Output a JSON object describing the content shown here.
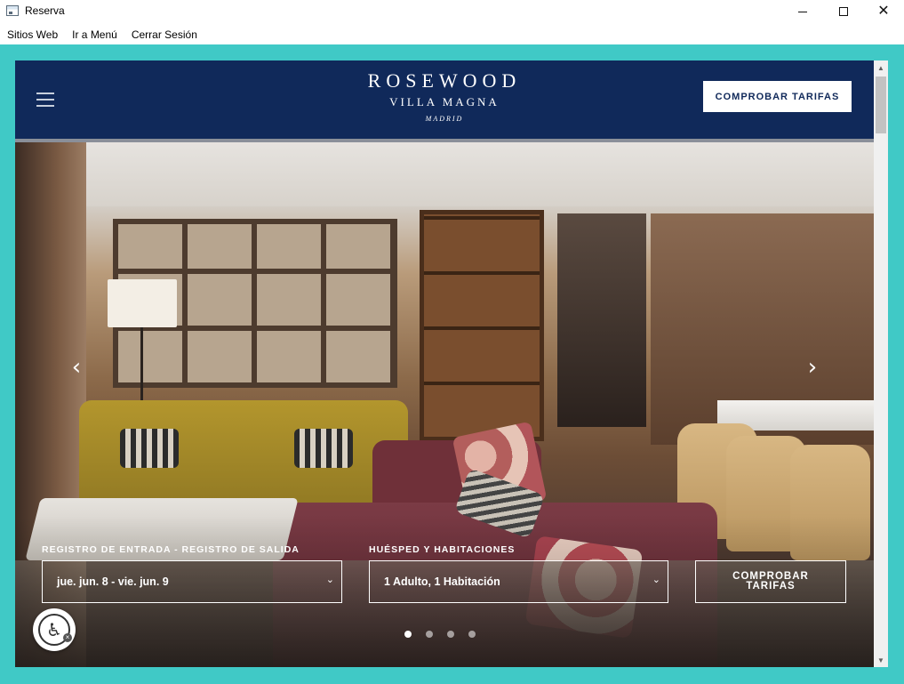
{
  "window": {
    "title": "Reserva",
    "controls": {
      "minimize": "minimize",
      "maximize": "maximize",
      "close": "✕"
    }
  },
  "menubar": {
    "items": [
      {
        "label": "Sitios Web"
      },
      {
        "label": "Ir a Menú"
      },
      {
        "label": "Cerrar Sesión"
      }
    ]
  },
  "colors": {
    "frame_teal": "#40c9c6",
    "header_navy": "#10295a",
    "white": "#ffffff"
  },
  "site": {
    "logo": {
      "main": "ROSEWOOD",
      "sub": "VILLA MAGNA",
      "city": "MADRID"
    },
    "header_cta": "COMPROBAR TARIFAS",
    "menu_icon": "hamburger-menu-icon"
  },
  "hero": {
    "prev_icon": "chevron-left-icon",
    "next_icon": "chevron-right-icon",
    "slides_total": 4,
    "active_slide": 1
  },
  "booking": {
    "dates_label": "REGISTRO DE ENTRADA - REGISTRO DE SALIDA",
    "dates_value": "jue. jun. 8 - vie. jun. 9",
    "guests_label": "HUÉSPED Y HABITACIONES",
    "guests_value": "1 Adulto, 1 Habitación",
    "cta": "COMPROBAR TARIFAS"
  },
  "accessibility": {
    "icon": "accessibility-icon"
  }
}
